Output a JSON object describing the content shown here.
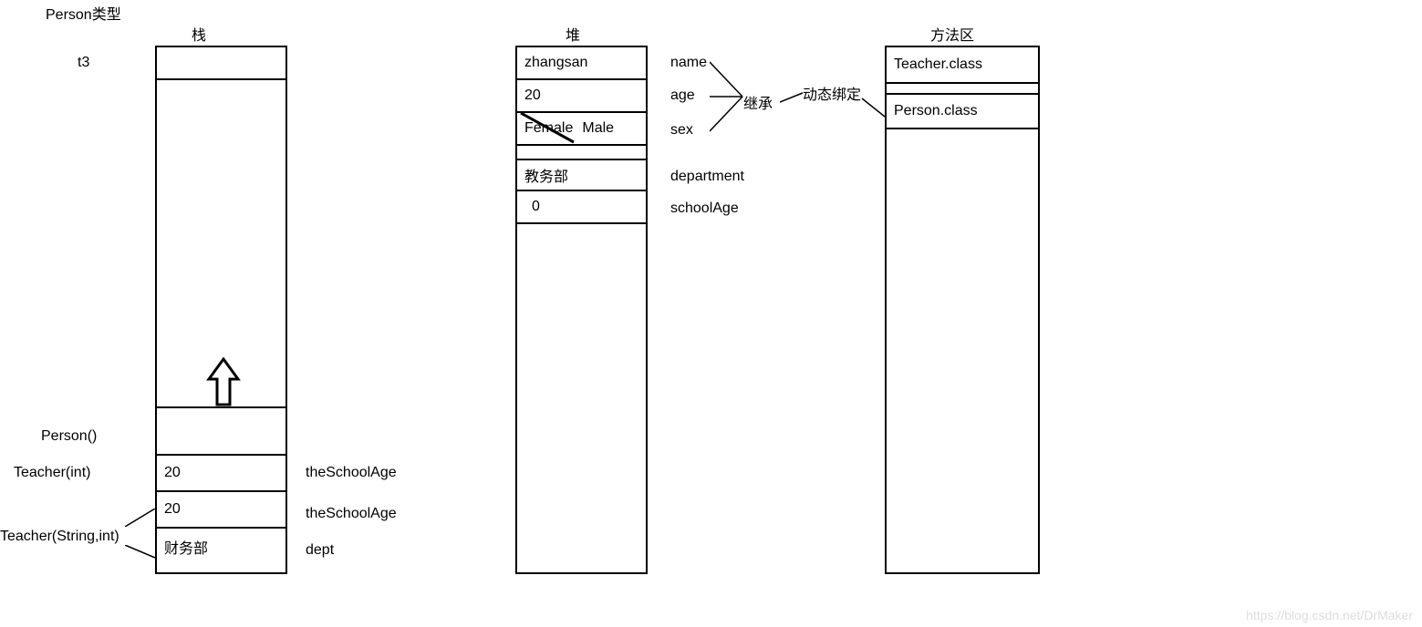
{
  "header": {
    "person_type": "Person类型",
    "stack_title": "栈",
    "heap_title": "堆",
    "method_area_title": "方法区"
  },
  "stack": {
    "t3_label": "t3",
    "frames": {
      "person_ctor": "Person()",
      "teacher_int": "Teacher(int)",
      "teacher_string_int": "Teacher(String,int)"
    },
    "cells": {
      "schoolAge1_val": "20",
      "schoolAge1_label": "theSchoolAge",
      "schoolAge2_val": "20",
      "schoolAge2_label": "theSchoolAge",
      "dept_val": "财务部",
      "dept_label": "dept"
    }
  },
  "heap": {
    "fields": {
      "name_val": "zhangsan",
      "name_label": "name",
      "age_val": "20",
      "age_label": "age",
      "sex_val_old": "Female",
      "sex_val_new": "Male",
      "sex_label": "sex",
      "department_val": "教务部",
      "department_label": "department",
      "schoolAge_val": "0",
      "schoolAge_label": "schoolAge"
    },
    "inherit_label": "继承",
    "dynamic_binding": "动态绑定"
  },
  "method_area": {
    "teacher_class": "Teacher.class",
    "person_class": "Person.class"
  },
  "watermark": "https://blog.csdn.net/DrMaker"
}
